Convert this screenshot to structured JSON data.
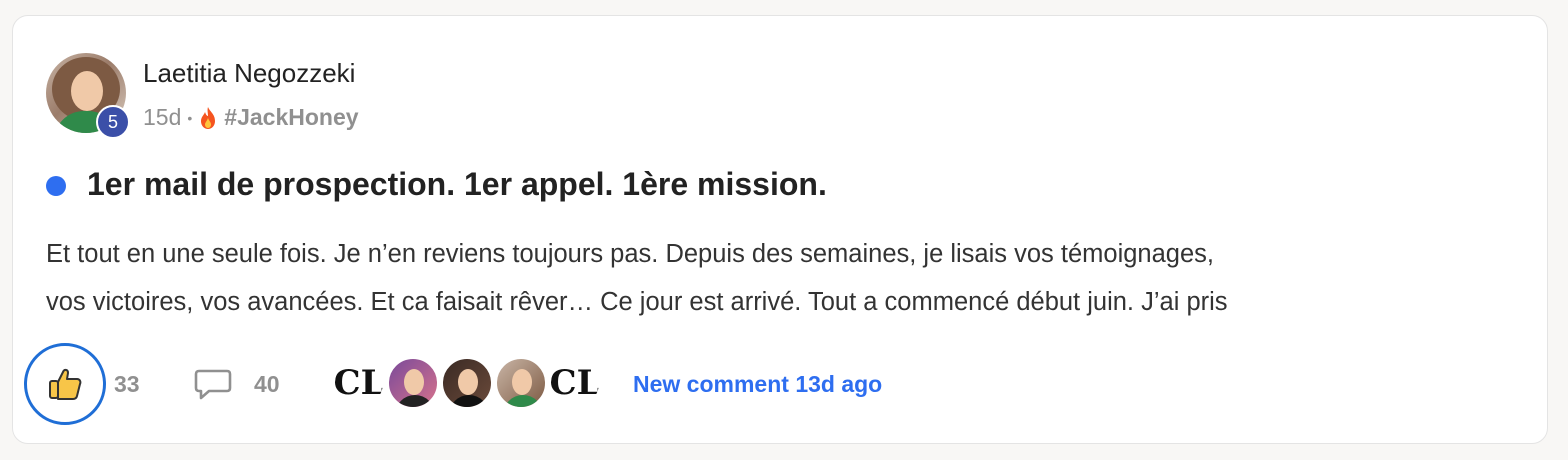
{
  "post": {
    "author": "Laetitia Negozzeki",
    "level": "5",
    "age": "15d",
    "separator": "•",
    "category": "#JackHoney",
    "title": "1er mail de prospection. 1er appel. 1ère mission.",
    "body_lines": [
      "Et tout en une seule fois. Je n’en reviens toujours pas. Depuis des semaines, je lisais vos témoignages,",
      "vos victoires, vos avancées. Et ca faisait rêver… Ce jour est arrivé. Tout a commencé début juin. J’ai pris"
    ]
  },
  "footer": {
    "likes": "33",
    "comments": "40",
    "participant_logo_letters": "CL",
    "new_comment": "New comment 13d ago"
  },
  "colors": {
    "accent": "#2e6ef0",
    "like_ring": "#1f6ed6",
    "level_badge": "#3b4fa8"
  },
  "icons": {
    "like": "thumbs-up-icon",
    "comment": "comment-bubble-icon",
    "category": "fire-icon"
  }
}
